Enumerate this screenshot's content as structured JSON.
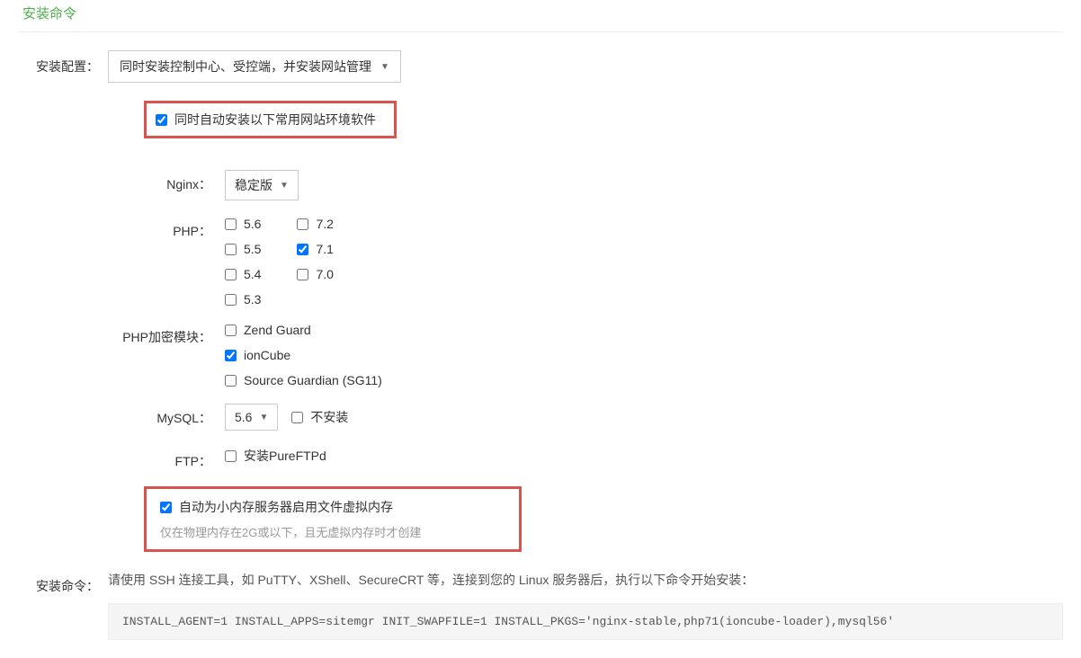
{
  "section_title": "安装命令",
  "labels": {
    "install_config": "安装配置：",
    "nginx": "Nginx：",
    "php": "PHP：",
    "php_encrypt": "PHP加密模块：",
    "mysql": "MySQL：",
    "ftp": "FTP：",
    "install_cmd": "安装命令："
  },
  "config_dropdown": "同时安装控制中心、受控端，并安装网站管理",
  "auto_install_env": "同时自动安装以下常用网站环境软件",
  "nginx_dropdown": "稳定版",
  "php_versions_col1": [
    "5.6",
    "5.5",
    "5.4",
    "5.3"
  ],
  "php_versions_col2": [
    "7.2",
    "7.1",
    "7.0"
  ],
  "php_checked": "7.1",
  "encrypt_modules": [
    {
      "name": "Zend Guard",
      "checked": false
    },
    {
      "name": "ionCube",
      "checked": true
    },
    {
      "name": "Source Guardian (SG11)",
      "checked": false
    }
  ],
  "mysql_dropdown": "5.6",
  "mysql_no_install": "不安装",
  "ftp_label": "安装PureFTPd",
  "swap": {
    "title": "自动为小内存服务器启用文件虚拟内存",
    "hint": "仅在物理内存在2G或以下，且无虚拟内存时才创建"
  },
  "cmd_hint": "请使用 SSH 连接工具，如 PuTTY、XShell、SecureCRT 等，连接到您的 Linux 服务器后，执行以下命令开始安装：",
  "cmd_code": "INSTALL_AGENT=1 INSTALL_APPS=sitemgr INIT_SWAPFILE=1 INSTALL_PKGS='nginx-stable,php71(ioncube-loader),mysql56'"
}
